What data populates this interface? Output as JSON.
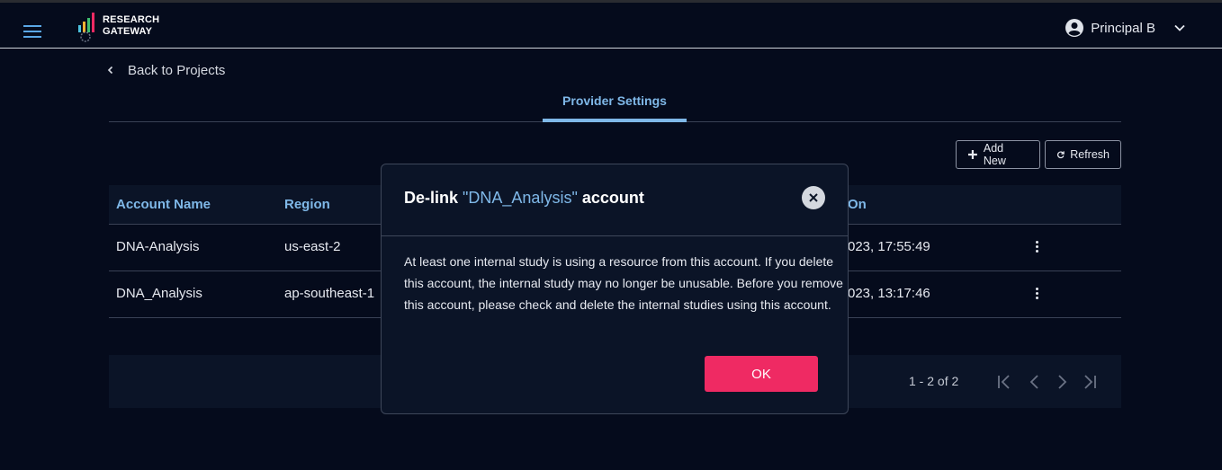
{
  "header": {
    "logo_line1": "RESEARCH",
    "logo_line2": "GATEWAY",
    "user_name": "Principal B"
  },
  "nav": {
    "back_label": "Back to Projects"
  },
  "tabs": [
    {
      "label": "Provider Settings",
      "active": true
    }
  ],
  "toolbar": {
    "add_label": "Add New",
    "refresh_label": "Refresh"
  },
  "table": {
    "columns": [
      "Account Name",
      "Region",
      "On"
    ],
    "rows": [
      {
        "account": "DNA-Analysis",
        "region": "us-east-2",
        "created": "023, 17:55:49"
      },
      {
        "account": "DNA_Analysis",
        "region": "ap-southeast-1",
        "created": "023, 13:17:46"
      }
    ]
  },
  "pagination": {
    "info": "1 - 2 of 2"
  },
  "modal": {
    "title_prefix": "De-link ",
    "account_name": "\"DNA_Analysis\"",
    "title_suffix": " account",
    "body": "At least one internal study is using a resource from this account. If you delete this account, the internal study may no longer be unusable. Before you remove this account, please check and delete the internal studies using this account.",
    "ok_label": "OK"
  },
  "colors": {
    "background": "#050b1c",
    "panel": "#0b1427",
    "accent": "#7fb8e8",
    "primary_button": "#ef2a63"
  }
}
